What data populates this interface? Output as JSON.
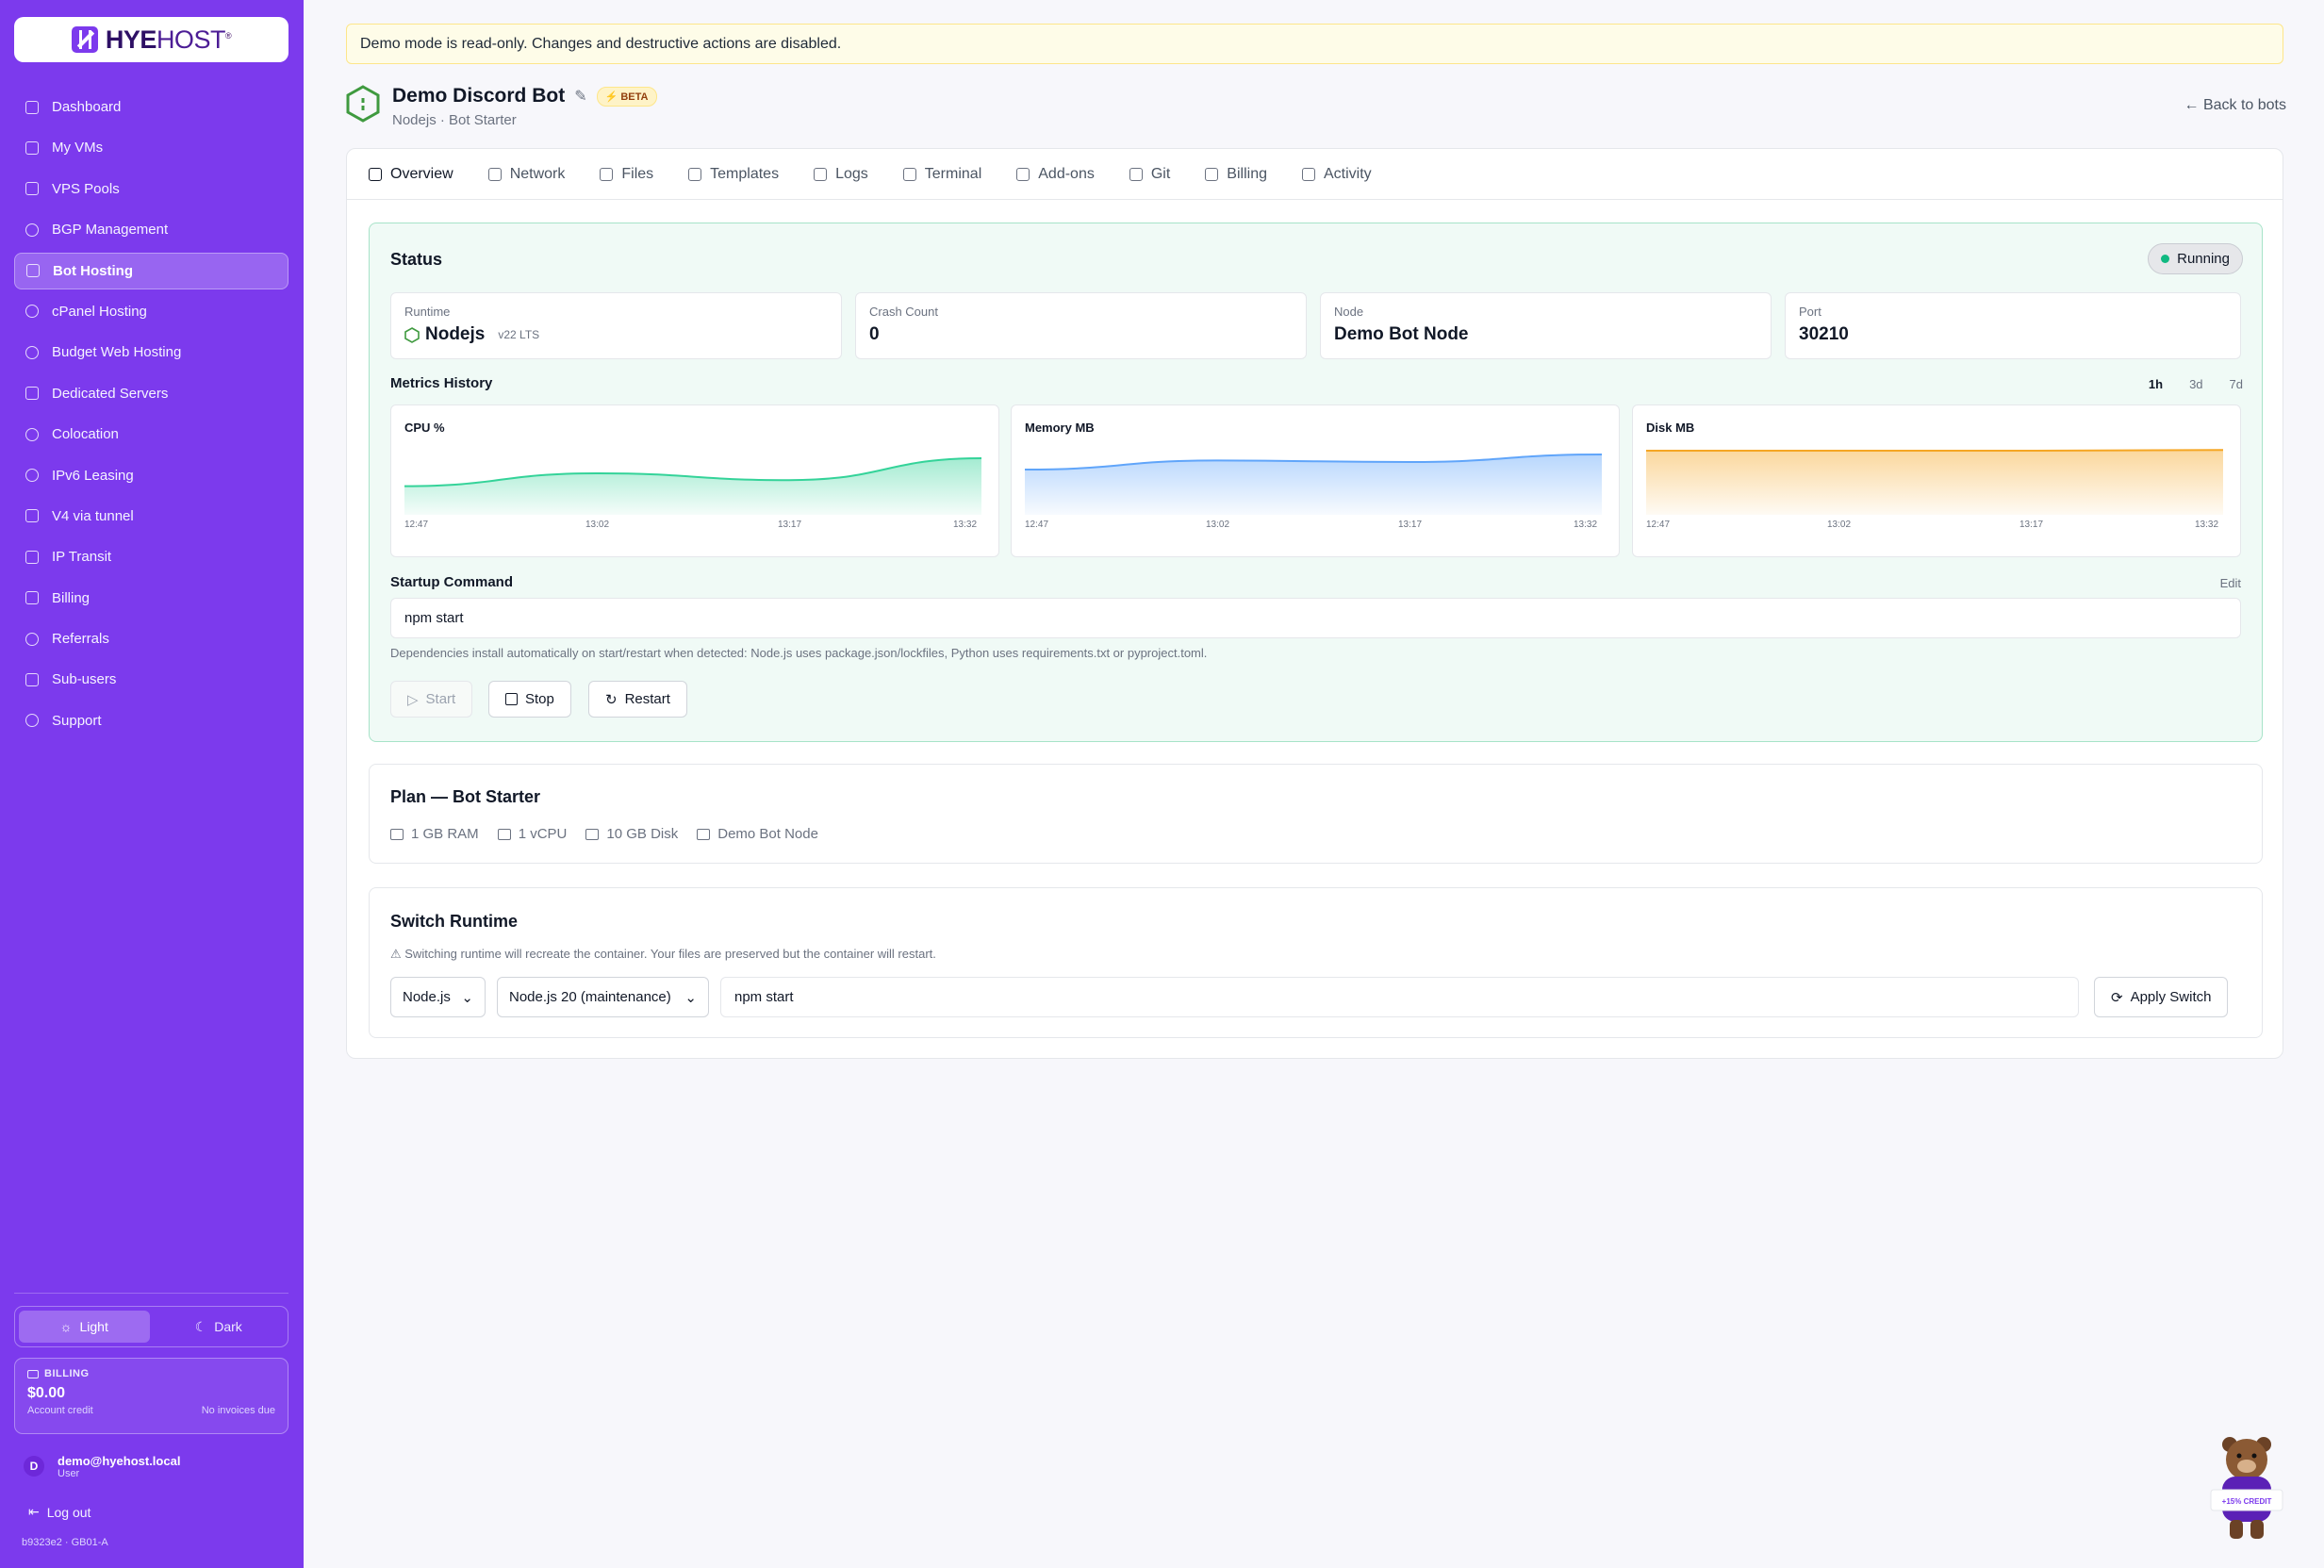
{
  "brand": {
    "name_bold": "HYE",
    "name_light": "HOST",
    "reg": "®"
  },
  "sidebar": {
    "items": [
      {
        "label": "Dashboard",
        "icon": "grid-icon"
      },
      {
        "label": "My VMs",
        "icon": "server-icon"
      },
      {
        "label": "VPS Pools",
        "icon": "layers-icon"
      },
      {
        "label": "BGP Management",
        "icon": "radio-icon"
      },
      {
        "label": "Bot Hosting",
        "icon": "bot-icon",
        "active": true
      },
      {
        "label": "cPanel Hosting",
        "icon": "globe-icon"
      },
      {
        "label": "Budget Web Hosting",
        "icon": "globe-icon"
      },
      {
        "label": "Dedicated Servers",
        "icon": "server-icon"
      },
      {
        "label": "Colocation",
        "icon": "globe-icon"
      },
      {
        "label": "IPv6 Leasing",
        "icon": "globe-icon"
      },
      {
        "label": "V4 via tunnel",
        "icon": "network-icon"
      },
      {
        "label": "IP Transit",
        "icon": "network-icon"
      },
      {
        "label": "Billing",
        "icon": "wallet-icon"
      },
      {
        "label": "Referrals",
        "icon": "gift-icon"
      },
      {
        "label": "Sub-users",
        "icon": "users-icon"
      },
      {
        "label": "Support",
        "icon": "headset-icon"
      }
    ],
    "theme": {
      "light": "Light",
      "dark": "Dark",
      "selected": "Light"
    },
    "billing": {
      "label": "BILLING",
      "amount": "$0.00",
      "credit_label": "Account credit",
      "invoices": "No invoices due"
    },
    "user": {
      "initial": "D",
      "email": "demo@hyehost.local",
      "role": "User"
    },
    "logout": "Log out",
    "version": "b9323e2 · GB01-A"
  },
  "banner": "Demo mode is read-only. Changes and destructive actions are disabled.",
  "bot": {
    "name": "Demo Discord Bot",
    "badge": "BETA",
    "subtitle": "Nodejs · Bot Starter",
    "back": "← Back to bots"
  },
  "tabs": [
    {
      "label": "Overview",
      "active": true
    },
    {
      "label": "Network"
    },
    {
      "label": "Files"
    },
    {
      "label": "Templates"
    },
    {
      "label": "Logs"
    },
    {
      "label": "Terminal"
    },
    {
      "label": "Add-ons"
    },
    {
      "label": "Git"
    },
    {
      "label": "Billing"
    },
    {
      "label": "Activity"
    }
  ],
  "status": {
    "title": "Status",
    "state": "Running",
    "stats": [
      {
        "key": "Runtime",
        "value": "Nodejs",
        "extra": "v22 LTS"
      },
      {
        "key": "Crash Count",
        "value": "0"
      },
      {
        "key": "Node",
        "value": "Demo Bot Node"
      },
      {
        "key": "Port",
        "value": "30210"
      }
    ],
    "metrics_title": "Metrics History",
    "ranges": [
      "1h",
      "3d",
      "7d"
    ],
    "selected_range": "1h"
  },
  "chart_data": [
    {
      "type": "area",
      "title": "CPU %",
      "x": [
        "12:47",
        "13:02",
        "13:17",
        "13:32"
      ],
      "values": [
        38,
        55,
        46,
        75
      ],
      "color": "#34d399"
    },
    {
      "type": "area",
      "title": "Memory MB",
      "x": [
        "12:47",
        "13:02",
        "13:17",
        "13:32"
      ],
      "values": [
        60,
        72,
        70,
        80
      ],
      "color": "#60a5fa"
    },
    {
      "type": "area",
      "title": "Disk MB",
      "x": [
        "12:47",
        "13:02",
        "13:17",
        "13:32"
      ],
      "values": [
        85,
        85,
        85,
        86
      ],
      "color": "#f5a623"
    }
  ],
  "startup": {
    "label": "Startup Command",
    "edit": "Edit",
    "command": "npm start",
    "hint": "Dependencies install automatically on start/restart when detected: Node.js uses package.json/lockfiles, Python uses requirements.txt or pyproject.toml.",
    "start": "Start",
    "stop": "Stop",
    "restart": "Restart"
  },
  "plan": {
    "title": "Plan — Bot Starter",
    "specs": [
      {
        "label": "1 GB RAM",
        "icon": "memory-icon"
      },
      {
        "label": "1 vCPU",
        "icon": "cpu-icon"
      },
      {
        "label": "10 GB Disk",
        "icon": "disk-icon"
      },
      {
        "label": "Demo Bot Node",
        "icon": "server-icon"
      }
    ]
  },
  "switch_runtime": {
    "title": "Switch Runtime",
    "warning": "⚠ Switching runtime will recreate the container. Your files are preserved but the container will restart.",
    "runtime": "Node.js",
    "version": "Node.js 20 (maintenance)",
    "command": "npm start",
    "apply": "Apply Switch"
  },
  "mascot": {
    "badge": "+15% CREDIT"
  }
}
